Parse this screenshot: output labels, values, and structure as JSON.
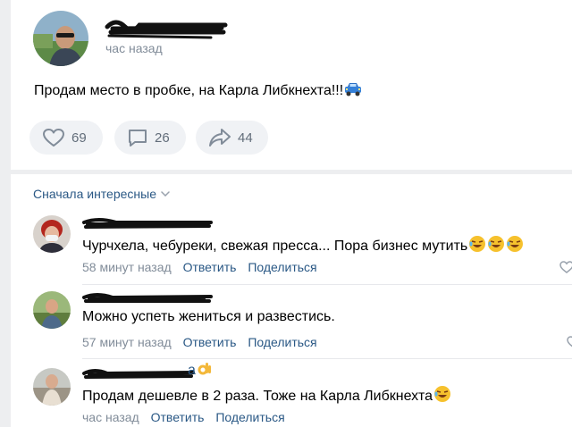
{
  "post": {
    "time": "час назад",
    "text": "Продам место в пробке, на Карла Либкнехта!!!",
    "emoji": "car-emoji",
    "likes": "69",
    "comments": "26",
    "shares": "44"
  },
  "comments_section": {
    "sort_label": "Сначала интересные"
  },
  "comments": [
    {
      "text": "Чурчхела, чебуреки, свежая пресса... Пора бизнес мутить",
      "emoji": "rolling-laughing-emoji x3",
      "time": "58 минут назад",
      "reply": "Ответить",
      "share": "Поделиться"
    },
    {
      "text": "Можно успеть жениться и развестись.",
      "time": "57 минут назад",
      "reply": "Ответить",
      "share": "Поделиться"
    },
    {
      "name_suffix": "а",
      "name_emoji": "ok-hand-emoji",
      "text": "Продам дешевле в 2 раза. Тоже на Карла Либкнехта",
      "emoji": "rolling-laughing-emoji",
      "time": "час назад",
      "reply": "Ответить",
      "share": "Поделиться"
    }
  ],
  "colors": {
    "link": "#2a5885",
    "muted": "#818c99",
    "button_bg": "#f0f2f5",
    "page_bg": "#edeef0"
  }
}
